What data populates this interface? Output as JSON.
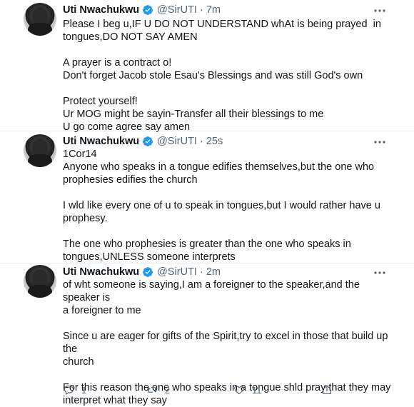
{
  "tweets": [
    {
      "name": "Uti Nwachukwu",
      "handle": "@SirUTI",
      "dot": "·",
      "time": "7m",
      "lines": [
        "Please I beg u,IF U DO NOT UNDERSTAND whAt is being prayed  in",
        "tongues,DO NOT SAY AMEN",
        "",
        "A prayer is a contract o!",
        "Don't forget Jacob stole Esau's Blessings and was still God's own",
        "",
        "Protect yourself!",
        "Ur MOG might be sayin-Transfer all their blessings to me",
        "U go come agree say amen"
      ]
    },
    {
      "name": "Uti Nwachukwu",
      "handle": "@SirUTI",
      "dot": "·",
      "time": "25s",
      "lines": [
        "1Cor14",
        "Anyone who speaks in a tongue edifies themselves,but the one who",
        "prophesies edifies the church",
        "",
        "I wld like every one of u to speak in tongues,but I would rather have u",
        "prophesy.",
        "",
        "The one who prophesies is greater than the one who speaks in",
        "tongues,UNLESS someone interprets"
      ]
    },
    {
      "name": "Uti Nwachukwu",
      "handle": "@SirUTI",
      "dot": "·",
      "time": "2m",
      "lines": [
        "of wht someone is saying,I am a foreigner to the speaker,and the speaker is",
        "a foreigner to me",
        "",
        "Since u are eager for gifts of the Spirit,try to excel in those that build up the",
        "church",
        "",
        "For this reason the one who speaks in a tongue shld pray that they may",
        "interpret what they say"
      ]
    }
  ],
  "actions": {
    "reply_count": "1",
    "retweet_count": "2",
    "like_count": "11"
  },
  "icons": {
    "verified": "verified-badge-icon",
    "more": "more-icon",
    "reply": "reply-icon",
    "retweet": "retweet-icon",
    "like": "like-icon",
    "share": "share-icon"
  },
  "colors": {
    "verified_blue": "#1d9bf0",
    "secondary_text": "#536471",
    "divider": "#e6ecf0"
  }
}
